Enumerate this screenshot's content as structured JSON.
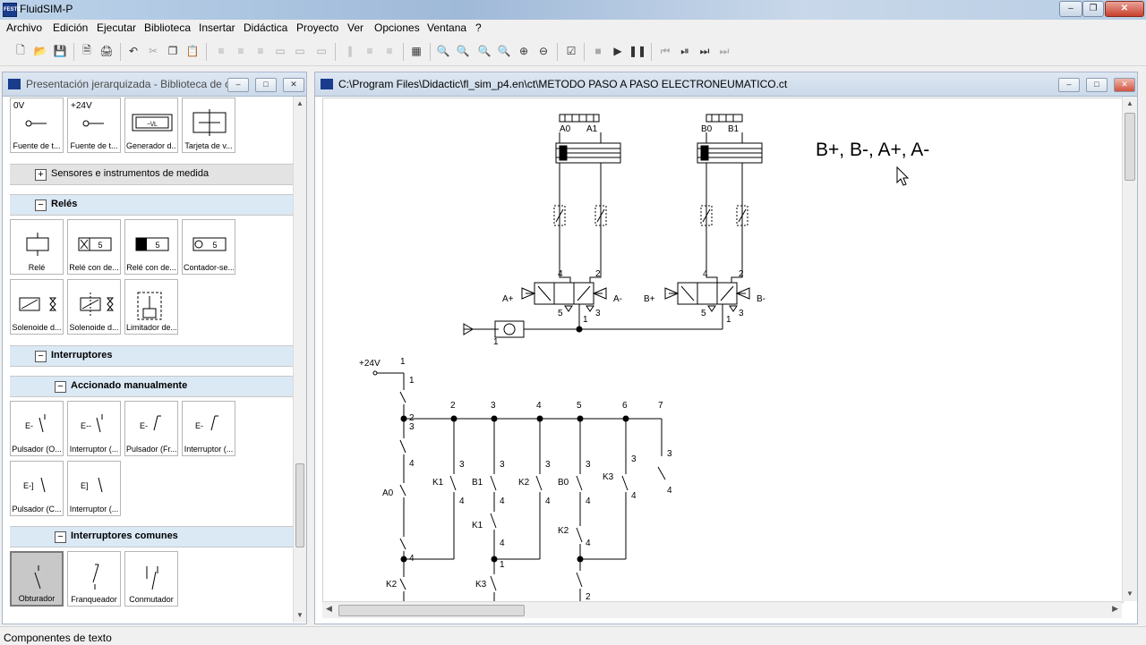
{
  "app": {
    "title": "FluidSIM-P",
    "icon": "festo-logo-icon"
  },
  "menu": [
    "Archivo",
    "Edición",
    "Ejecutar",
    "Biblioteca",
    "Insertar",
    "Didáctica",
    "Proyecto",
    "Ver",
    "Opciones",
    "Ventana",
    "?"
  ],
  "library": {
    "title": "Presentación jerarquizada - Biblioteca de c...",
    "row1": [
      {
        "top": "0V",
        "label": "Fuente de t..."
      },
      {
        "top": "+24V",
        "label": "Fuente de t..."
      },
      {
        "top": "",
        "label": "Generador d..."
      },
      {
        "top": "",
        "label": "Tarjeta de v..."
      }
    ],
    "groups": {
      "sensores": "Sensores e instrumentos de medida",
      "reles": "Relés",
      "interruptores": "Interruptores",
      "manual": "Accionado manualmente",
      "comunes": "Interruptores comunes"
    },
    "reles": [
      "Relé",
      "Relé con de...",
      "Relé con de...",
      "Contador-se...",
      "Solenoide d...",
      "Solenoide d...",
      "Limitador de..."
    ],
    "manual": [
      "Pulsador (O...",
      "Interruptor (...",
      "Pulsador (Fr...",
      "Interruptor (...",
      "Pulsador (C...",
      "Interruptor (..."
    ],
    "comunes": [
      "Obturador",
      "Franqueador",
      "Conmutador"
    ],
    "tile_glyph": "5"
  },
  "drawing": {
    "title": "C:\\Program Files\\Didactic\\fl_sim_p4.en\\ct\\METODO PASO A PASO ELECTRONEUMATICO.ct",
    "sequence": "B+, B-, A+, A-",
    "pneumatic": {
      "cylA_left": "A0",
      "cylA_right": "A1",
      "cylB_left": "B0",
      "cylB_right": "B1",
      "port4": "4",
      "port2": "2",
      "port5": "5",
      "port1": "1",
      "port3": "3",
      "solA_plus": "A+",
      "solA_minus": "A-",
      "solB_plus": "B+",
      "solB_minus": "B-",
      "supply_port": "1"
    },
    "electric": {
      "supply": "+24V",
      "column_numbers": [
        "1",
        "2",
        "3",
        "4",
        "5",
        "6",
        "7"
      ],
      "contacts": [
        "K1",
        "B1",
        "K2",
        "B0",
        "K3",
        "K1",
        "K2",
        "K2",
        "K3",
        "A0"
      ],
      "terminals": [
        "1",
        "2",
        "3",
        "4"
      ]
    }
  },
  "status": "Componentes de texto"
}
